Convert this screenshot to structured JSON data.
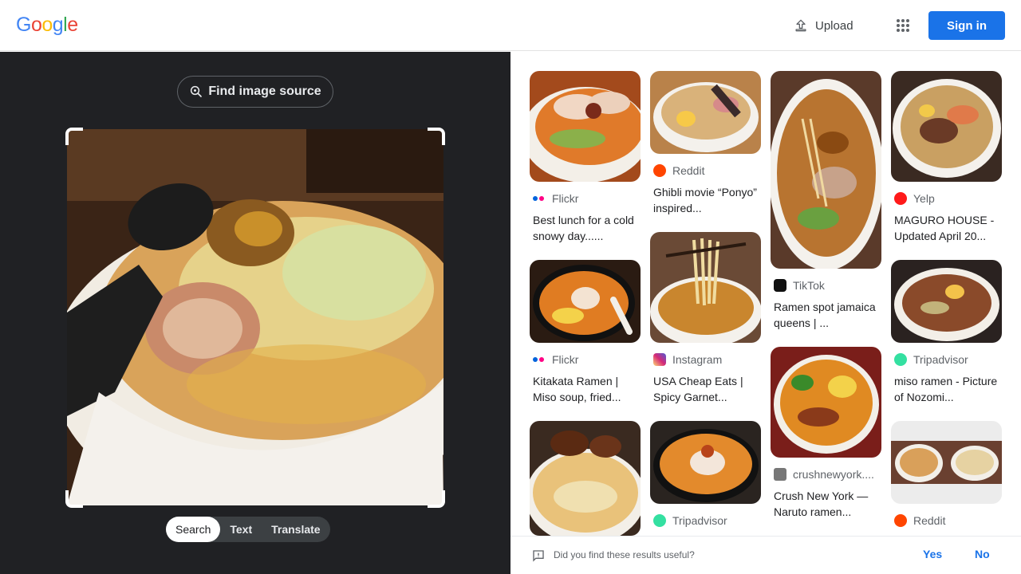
{
  "header": {
    "logo_letters": [
      {
        "ch": "G",
        "color": "#4285F4"
      },
      {
        "ch": "o",
        "color": "#EA4335"
      },
      {
        "ch": "o",
        "color": "#FBBC05"
      },
      {
        "ch": "g",
        "color": "#4285F4"
      },
      {
        "ch": "l",
        "color": "#34A853"
      },
      {
        "ch": "e",
        "color": "#EA4335"
      }
    ],
    "upload_label": "Upload",
    "upload_icon": "upload-icon",
    "apps_icon": "apps-grid-icon",
    "signin_label": "Sign in",
    "accent": "#1a73e8"
  },
  "left": {
    "find_source_label": "Find image source",
    "find_source_icon": "lens-search-icon",
    "tabs": [
      {
        "label": "Search",
        "active": true
      },
      {
        "label": "Text",
        "active": false
      },
      {
        "label": "Translate",
        "active": false
      }
    ]
  },
  "results": [
    {
      "source": "Flickr",
      "title": "Best lunch for a cold snowy day......",
      "icon": "flickr-icon"
    },
    {
      "source": "Flickr",
      "title": "Kitakata Ramen | Miso soup, fried...",
      "icon": "flickr-icon"
    },
    {
      "source": "",
      "title": "",
      "icon": ""
    },
    {
      "source": "Reddit",
      "title": "Ghibli movie “Ponyo” inspired...",
      "icon": "reddit-icon"
    },
    {
      "source": "Instagram",
      "title": "USA Cheap Eats | Spicy Garnet...",
      "icon": "instagram-icon"
    },
    {
      "source": "Tripadvisor",
      "title": "",
      "icon": "tripadvisor-icon"
    },
    {
      "source": "TikTok",
      "title": "Ramen spot jamaica queens | ...",
      "icon": "tiktok-icon"
    },
    {
      "source": "crushnewyork....",
      "title": "Crush New York — Naruto ramen...",
      "icon": "site-icon"
    },
    {
      "source": "Yelp",
      "title": "MAGURO HOUSE - Updated April 20...",
      "icon": "yelp-icon"
    },
    {
      "source": "Tripadvisor",
      "title": "miso ramen - Picture of Nozomi...",
      "icon": "tripadvisor-icon"
    },
    {
      "source": "Reddit",
      "title": "",
      "icon": "reddit-icon"
    }
  ],
  "feedback": {
    "question": "Did you find these results useful?",
    "yes": "Yes",
    "no": "No",
    "icon": "feedback-icon"
  }
}
